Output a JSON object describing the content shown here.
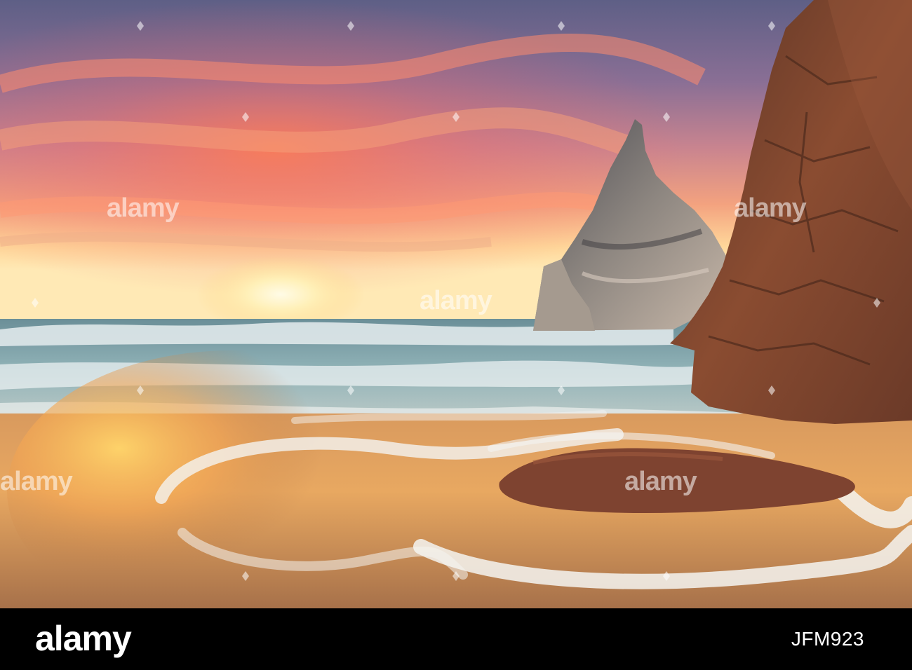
{
  "image": {
    "subject": "sunset-seascape",
    "palette": {
      "sky_top": "#6d6a8e",
      "sky_glow": "#f28a62",
      "sun": "#fff4c8",
      "sea": "#5f8c96",
      "foam": "#e8eef0",
      "sand": "#c78a52",
      "rock": "#7a4530",
      "rock_light": "#b9a79a"
    }
  },
  "watermark": {
    "text": "alamy"
  },
  "footer": {
    "brand": "alamy",
    "image_id": "JFM923",
    "background": "#000000"
  }
}
